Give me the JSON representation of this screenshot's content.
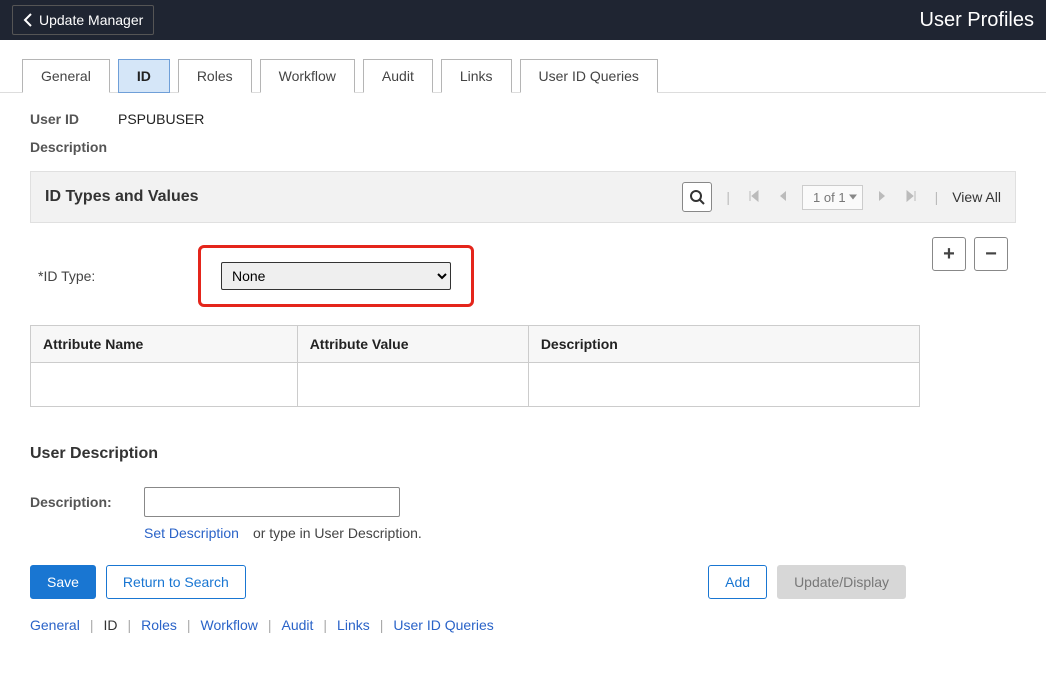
{
  "header": {
    "back_label": "Update Manager",
    "page_title": "User Profiles"
  },
  "tabs": {
    "general": "General",
    "id": "ID",
    "roles": "Roles",
    "workflow": "Workflow",
    "audit": "Audit",
    "links": "Links",
    "user_id_queries": "User ID Queries"
  },
  "fields": {
    "user_id_label": "User ID",
    "user_id_value": "PSPUBUSER",
    "description_label": "Description"
  },
  "section": {
    "title": "ID Types and Values",
    "search_icon": "search-icon",
    "page_indicator": "1 of 1",
    "view_all": "View All"
  },
  "idtype": {
    "label": "*ID Type:",
    "selected": "None",
    "add_icon": "+",
    "remove_icon": "−"
  },
  "table": {
    "col1": "Attribute Name",
    "col2": "Attribute Value",
    "col3": "Description"
  },
  "user_desc": {
    "title": "User Description",
    "desc_label": "Description:",
    "set_desc_link": "Set Description",
    "helper": "or type in User Description."
  },
  "buttons": {
    "save": "Save",
    "return": "Return to Search",
    "add": "Add",
    "update": "Update/Display"
  },
  "bottom_nav": {
    "general": "General",
    "id": "ID",
    "roles": "Roles",
    "workflow": "Workflow",
    "audit": "Audit",
    "links": "Links",
    "user_id_queries": "User ID Queries"
  }
}
